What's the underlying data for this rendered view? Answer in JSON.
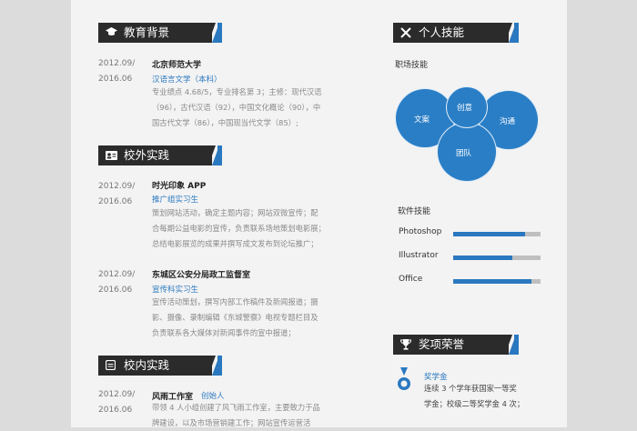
{
  "education": {
    "header": "教育背景",
    "date_start": "2012.09/",
    "date_end": "2016.06",
    "school": "北京师范大学",
    "major": "汉语言文学（本科）",
    "desc_lines": [
      "专业绩点 4.68/5，专业排名第 3；主修：现代汉语",
      "（96），古代汉语（92），中国文化概论（90），中",
      "国古代文学（86），中国现当代文学（85）;"
    ]
  },
  "external": {
    "header": "校外实践",
    "items": [
      {
        "date_start": "2012.09/",
        "date_end": "2016.06",
        "org": "时光印象 APP",
        "role": "推广组实习生",
        "lines": [
          "策划网站活动，确定主题内容；网站双微宣传；配",
          "合每期公益电影的宣传，负责联系场地策划电影展；",
          "总结电影展览的成果并撰写成文发布到论坛推广；"
        ]
      },
      {
        "date_start": "2012.09/",
        "date_end": "2016.06",
        "org": "东城区公安分局政工监督室",
        "role": "宣传科实习生",
        "lines": [
          "宣传活动策划，撰写内部工作稿件及新闻报道；摄",
          "影、摄像、录制编辑《东城警察》电视专题栏目及",
          "负责联系各大媒体对新闻事件的宣中报道；"
        ]
      }
    ]
  },
  "campus": {
    "header": "校内实践",
    "date_start": "2012.09/",
    "date_end": "2016.06",
    "org": "风雨工作室",
    "role": "创始人",
    "lines": [
      "带领 4 人小组创建了风飞雨工作室，主要致力于品",
      "牌建设，以及市场营销建工作；网站宣传运营活"
    ]
  },
  "skills": {
    "header": "个人技能",
    "workplace_title": "职场技能",
    "circles": [
      "文案",
      "创意",
      "沟通",
      "团队"
    ],
    "software_title": "软件技能",
    "software": [
      {
        "name": "Photoshop",
        "level": 0.82
      },
      {
        "name": "Illustrator",
        "level": 0.68
      },
      {
        "name": "Office",
        "level": 0.9
      }
    ]
  },
  "awards": {
    "header": "奖项荣誉",
    "title": "奖学金",
    "lines": [
      "连续 3 个学年获国家一等奖",
      "学金；校级二等奖学金 4 次；"
    ]
  },
  "colors": {
    "accent": "#2a78c0",
    "dark": "#2b2b2b"
  }
}
